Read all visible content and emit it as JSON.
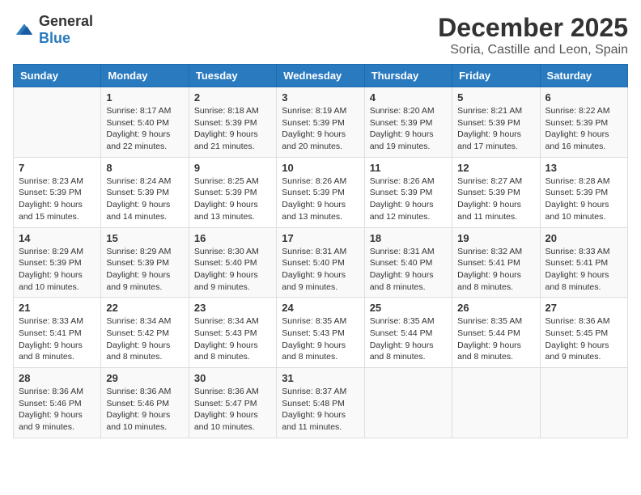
{
  "header": {
    "logo_general": "General",
    "logo_blue": "Blue",
    "title": "December 2025",
    "subtitle": "Soria, Castille and Leon, Spain"
  },
  "weekdays": [
    "Sunday",
    "Monday",
    "Tuesday",
    "Wednesday",
    "Thursday",
    "Friday",
    "Saturday"
  ],
  "weeks": [
    [
      {
        "day": "",
        "info": ""
      },
      {
        "day": "1",
        "info": "Sunrise: 8:17 AM\nSunset: 5:40 PM\nDaylight: 9 hours\nand 22 minutes."
      },
      {
        "day": "2",
        "info": "Sunrise: 8:18 AM\nSunset: 5:39 PM\nDaylight: 9 hours\nand 21 minutes."
      },
      {
        "day": "3",
        "info": "Sunrise: 8:19 AM\nSunset: 5:39 PM\nDaylight: 9 hours\nand 20 minutes."
      },
      {
        "day": "4",
        "info": "Sunrise: 8:20 AM\nSunset: 5:39 PM\nDaylight: 9 hours\nand 19 minutes."
      },
      {
        "day": "5",
        "info": "Sunrise: 8:21 AM\nSunset: 5:39 PM\nDaylight: 9 hours\nand 17 minutes."
      },
      {
        "day": "6",
        "info": "Sunrise: 8:22 AM\nSunset: 5:39 PM\nDaylight: 9 hours\nand 16 minutes."
      }
    ],
    [
      {
        "day": "7",
        "info": "Sunrise: 8:23 AM\nSunset: 5:39 PM\nDaylight: 9 hours\nand 15 minutes."
      },
      {
        "day": "8",
        "info": "Sunrise: 8:24 AM\nSunset: 5:39 PM\nDaylight: 9 hours\nand 14 minutes."
      },
      {
        "day": "9",
        "info": "Sunrise: 8:25 AM\nSunset: 5:39 PM\nDaylight: 9 hours\nand 13 minutes."
      },
      {
        "day": "10",
        "info": "Sunrise: 8:26 AM\nSunset: 5:39 PM\nDaylight: 9 hours\nand 13 minutes."
      },
      {
        "day": "11",
        "info": "Sunrise: 8:26 AM\nSunset: 5:39 PM\nDaylight: 9 hours\nand 12 minutes."
      },
      {
        "day": "12",
        "info": "Sunrise: 8:27 AM\nSunset: 5:39 PM\nDaylight: 9 hours\nand 11 minutes."
      },
      {
        "day": "13",
        "info": "Sunrise: 8:28 AM\nSunset: 5:39 PM\nDaylight: 9 hours\nand 10 minutes."
      }
    ],
    [
      {
        "day": "14",
        "info": "Sunrise: 8:29 AM\nSunset: 5:39 PM\nDaylight: 9 hours\nand 10 minutes."
      },
      {
        "day": "15",
        "info": "Sunrise: 8:29 AM\nSunset: 5:39 PM\nDaylight: 9 hours\nand 9 minutes."
      },
      {
        "day": "16",
        "info": "Sunrise: 8:30 AM\nSunset: 5:40 PM\nDaylight: 9 hours\nand 9 minutes."
      },
      {
        "day": "17",
        "info": "Sunrise: 8:31 AM\nSunset: 5:40 PM\nDaylight: 9 hours\nand 9 minutes."
      },
      {
        "day": "18",
        "info": "Sunrise: 8:31 AM\nSunset: 5:40 PM\nDaylight: 9 hours\nand 8 minutes."
      },
      {
        "day": "19",
        "info": "Sunrise: 8:32 AM\nSunset: 5:41 PM\nDaylight: 9 hours\nand 8 minutes."
      },
      {
        "day": "20",
        "info": "Sunrise: 8:33 AM\nSunset: 5:41 PM\nDaylight: 9 hours\nand 8 minutes."
      }
    ],
    [
      {
        "day": "21",
        "info": "Sunrise: 8:33 AM\nSunset: 5:41 PM\nDaylight: 9 hours\nand 8 minutes."
      },
      {
        "day": "22",
        "info": "Sunrise: 8:34 AM\nSunset: 5:42 PM\nDaylight: 9 hours\nand 8 minutes."
      },
      {
        "day": "23",
        "info": "Sunrise: 8:34 AM\nSunset: 5:43 PM\nDaylight: 9 hours\nand 8 minutes."
      },
      {
        "day": "24",
        "info": "Sunrise: 8:35 AM\nSunset: 5:43 PM\nDaylight: 9 hours\nand 8 minutes."
      },
      {
        "day": "25",
        "info": "Sunrise: 8:35 AM\nSunset: 5:44 PM\nDaylight: 9 hours\nand 8 minutes."
      },
      {
        "day": "26",
        "info": "Sunrise: 8:35 AM\nSunset: 5:44 PM\nDaylight: 9 hours\nand 8 minutes."
      },
      {
        "day": "27",
        "info": "Sunrise: 8:36 AM\nSunset: 5:45 PM\nDaylight: 9 hours\nand 9 minutes."
      }
    ],
    [
      {
        "day": "28",
        "info": "Sunrise: 8:36 AM\nSunset: 5:46 PM\nDaylight: 9 hours\nand 9 minutes."
      },
      {
        "day": "29",
        "info": "Sunrise: 8:36 AM\nSunset: 5:46 PM\nDaylight: 9 hours\nand 10 minutes."
      },
      {
        "day": "30",
        "info": "Sunrise: 8:36 AM\nSunset: 5:47 PM\nDaylight: 9 hours\nand 10 minutes."
      },
      {
        "day": "31",
        "info": "Sunrise: 8:37 AM\nSunset: 5:48 PM\nDaylight: 9 hours\nand 11 minutes."
      },
      {
        "day": "",
        "info": ""
      },
      {
        "day": "",
        "info": ""
      },
      {
        "day": "",
        "info": ""
      }
    ]
  ]
}
